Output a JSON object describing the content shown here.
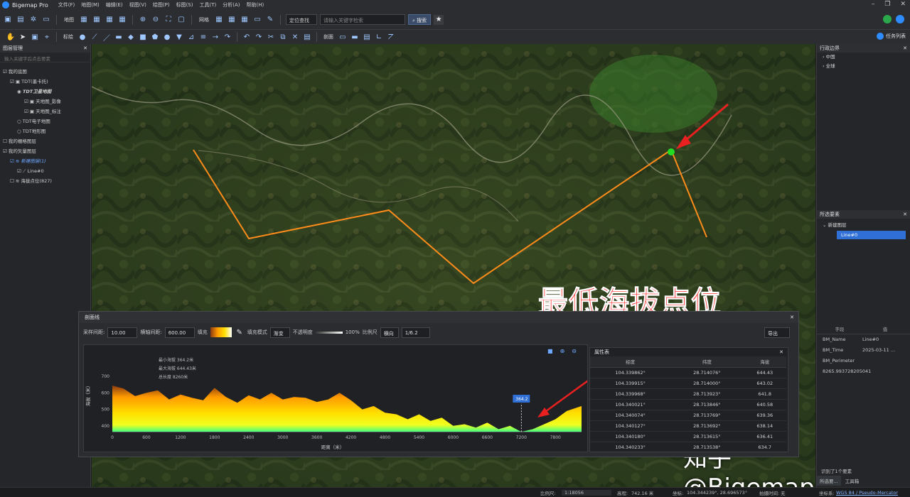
{
  "app": {
    "name": "Bigemap Pro",
    "menu": [
      "文件(F)",
      "地图(M)",
      "编辑(E)",
      "视图(V)",
      "绘图(P)",
      "标图(S)",
      "工具(T)",
      "分析(A)",
      "帮助(H)"
    ]
  },
  "toolbar1": {
    "map_label": "地图",
    "grid_label": "网格",
    "locate_label": "定位查找",
    "search_placeholder": "请输入关键字检索",
    "search_button": "搜索"
  },
  "toolbar2": {
    "mark_label": "标绘",
    "section_label": "剖面",
    "task_label": "任务列表"
  },
  "layers": {
    "title": "图层管理",
    "search_placeholder": "输入关键字后点击要素",
    "items": [
      "我的底图",
      "TDT(墨卡托)",
      "TDT卫星地图",
      "天地图_影像",
      "天地图_标注",
      "TDT电子地图",
      "TDT地形图",
      "我的栅格图层",
      "我的矢量图层",
      "新建图层(1)",
      "Line#0",
      "海拔点位(827)"
    ]
  },
  "region": {
    "title": "行政边界",
    "items": [
      "中国",
      "全球"
    ]
  },
  "selected": {
    "title": "所选要素",
    "layer": "新建图层",
    "feature": "Line#0",
    "prop_headers": [
      "字段",
      "值"
    ],
    "props": [
      {
        "k": "BM_Name",
        "v": "Line#0"
      },
      {
        "k": "BM_Time",
        "v": "2025-03-11 ..."
      },
      {
        "k": "BM_Perimeter",
        "v": "8265.993728205041"
      }
    ],
    "count": "识别了1个要素",
    "tabs": [
      "所选要...",
      "工具箱"
    ]
  },
  "annotation": {
    "main": "最低海拔点位",
    "watermark": "知乎 @Bigemap"
  },
  "profile": {
    "title": "剖面线",
    "controls": {
      "sample_label": "采样间距:",
      "sample": "10.00",
      "horiz_label": "横轴间距:",
      "horiz": "600.00",
      "color_label": "填充",
      "mode_label": "填充模式",
      "mode": "渐变",
      "opacity_label": "不透明度",
      "opacity": "100%",
      "scale_label": "比例尺",
      "scale_dir": "横向",
      "scale": "1/6.2",
      "export": "导出"
    },
    "stats": {
      "min": "最小海拔 364.2米",
      "max": "最大海拔 644.43米",
      "length": "总长度 8260米"
    },
    "xlabel": "距离（米）",
    "ylabel": "海拔（米）",
    "marker_label": "364.2",
    "attr_title": "属性表",
    "attr_headers": [
      "经度",
      "纬度",
      "海拔"
    ],
    "rows": [
      [
        "104.339862°",
        "28.714076°",
        "644.43"
      ],
      [
        "104.339915°",
        "28.714000°",
        "643.02"
      ],
      [
        "104.339968°",
        "28.713923°",
        "641.8"
      ],
      [
        "104.340021°",
        "28.713846°",
        "640.58"
      ],
      [
        "104.340074°",
        "28.713769°",
        "639.36"
      ],
      [
        "104.340127°",
        "28.713692°",
        "638.14"
      ],
      [
        "104.340180°",
        "28.713615°",
        "636.41"
      ],
      [
        "104.340233°",
        "28.713538°",
        "634.7"
      ]
    ]
  },
  "status": {
    "scale_label": "比例尺:",
    "scale": "1:18056",
    "elev_label": "高程:",
    "elev": "742.16 米",
    "coord_label": "坐标:",
    "coord": "104.344239°, 28.696573°",
    "time_label": "拍摄时间:",
    "time": "无",
    "crs_label": "坐标系:",
    "crs": "WGS 84 / Pseudo-Mercator"
  },
  "chart_data": {
    "type": "area",
    "xlabel": "距离（米）",
    "ylabel": "海拔（米）",
    "x": [
      0,
      200,
      400,
      600,
      800,
      1000,
      1200,
      1400,
      1600,
      1800,
      2000,
      2200,
      2400,
      2600,
      2800,
      3000,
      3200,
      3400,
      3600,
      3800,
      4000,
      4200,
      4400,
      4600,
      4800,
      5000,
      5200,
      5400,
      5600,
      5800,
      6000,
      6200,
      6400,
      6600,
      6800,
      7000,
      7200,
      7400,
      7600,
      7800,
      8000,
      8260
    ],
    "y": [
      644,
      625,
      580,
      600,
      615,
      560,
      590,
      570,
      555,
      630,
      575,
      540,
      585,
      560,
      600,
      560,
      575,
      570,
      545,
      560,
      600,
      555,
      500,
      520,
      480,
      470,
      440,
      470,
      430,
      450,
      400,
      410,
      390,
      420,
      380,
      400,
      364,
      380,
      410,
      440,
      490,
      520
    ],
    "xlim": [
      0,
      8260
    ],
    "ylim": [
      365,
      760
    ],
    "xticks": [
      0,
      600,
      1200,
      1800,
      2400,
      3000,
      3600,
      4200,
      4800,
      5400,
      6000,
      6600,
      7200,
      7800
    ],
    "yticks": [
      400,
      500,
      600,
      700
    ]
  }
}
